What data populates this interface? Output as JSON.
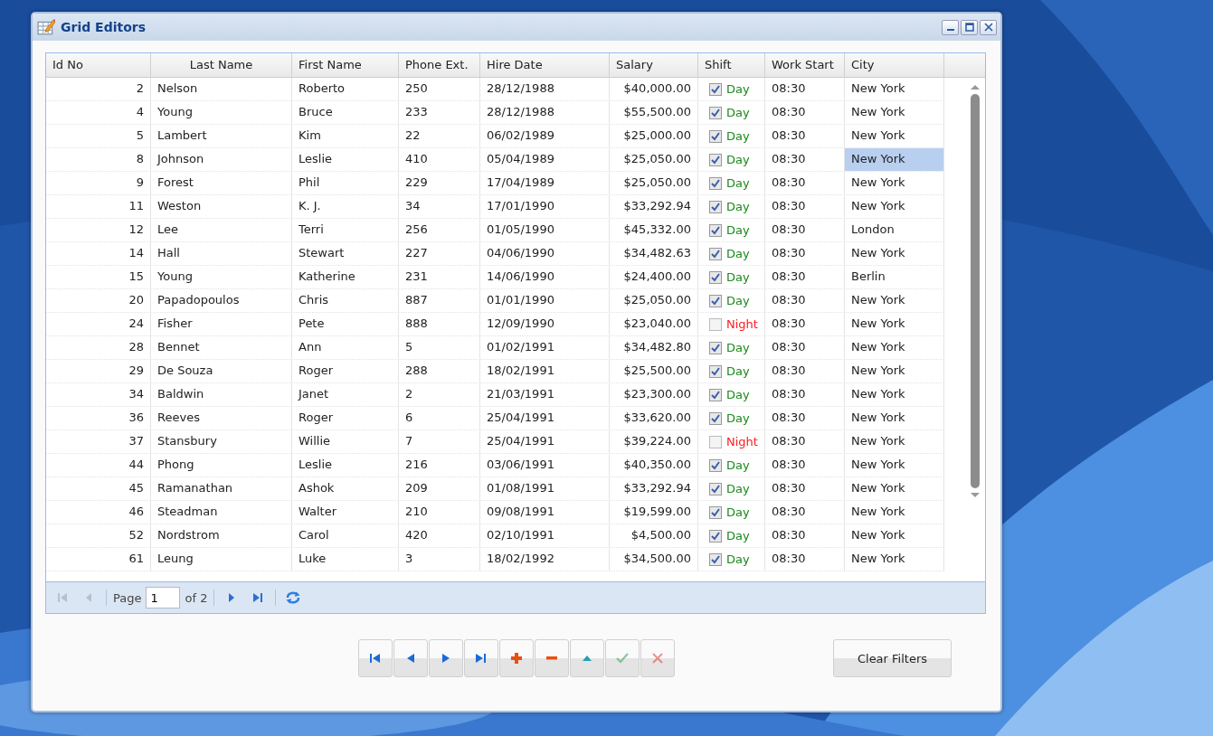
{
  "window": {
    "title": "Grid Editors"
  },
  "table": {
    "columns": [
      "Id No",
      "Last Name",
      "First Name",
      "Phone Ext.",
      "Hire Date",
      "Salary",
      "Shift",
      "Work Start",
      "City"
    ],
    "rows": [
      {
        "id": "2",
        "last": "Nelson",
        "first": "Roberto",
        "ext": "250",
        "hired": "28/12/1988",
        "salary": "$40,000.00",
        "shift": {
          "checked": true,
          "label": "Day"
        },
        "start": "08:30",
        "city": "New York",
        "selected": false
      },
      {
        "id": "4",
        "last": "Young",
        "first": "Bruce",
        "ext": "233",
        "hired": "28/12/1988",
        "salary": "$55,500.00",
        "shift": {
          "checked": true,
          "label": "Day"
        },
        "start": "08:30",
        "city": "New York",
        "selected": false
      },
      {
        "id": "5",
        "last": "Lambert",
        "first": "Kim",
        "ext": "22",
        "hired": "06/02/1989",
        "salary": "$25,000.00",
        "shift": {
          "checked": true,
          "label": "Day"
        },
        "start": "08:30",
        "city": "New York",
        "selected": false
      },
      {
        "id": "8",
        "last": "Johnson",
        "first": "Leslie",
        "ext": "410",
        "hired": "05/04/1989",
        "salary": "$25,050.00",
        "shift": {
          "checked": true,
          "label": "Day"
        },
        "start": "08:30",
        "city": "New York",
        "selected": true
      },
      {
        "id": "9",
        "last": "Forest",
        "first": "Phil",
        "ext": "229",
        "hired": "17/04/1989",
        "salary": "$25,050.00",
        "shift": {
          "checked": true,
          "label": "Day"
        },
        "start": "08:30",
        "city": "New York",
        "selected": false
      },
      {
        "id": "11",
        "last": "Weston",
        "first": "K. J.",
        "ext": "34",
        "hired": "17/01/1990",
        "salary": "$33,292.94",
        "shift": {
          "checked": true,
          "label": "Day"
        },
        "start": "08:30",
        "city": "New York",
        "selected": false
      },
      {
        "id": "12",
        "last": "Lee",
        "first": "Terri",
        "ext": "256",
        "hired": "01/05/1990",
        "salary": "$45,332.00",
        "shift": {
          "checked": true,
          "label": "Day"
        },
        "start": "08:30",
        "city": "London",
        "selected": false
      },
      {
        "id": "14",
        "last": "Hall",
        "first": "Stewart",
        "ext": "227",
        "hired": "04/06/1990",
        "salary": "$34,482.63",
        "shift": {
          "checked": true,
          "label": "Day"
        },
        "start": "08:30",
        "city": "New York",
        "selected": false
      },
      {
        "id": "15",
        "last": "Young",
        "first": "Katherine",
        "ext": "231",
        "hired": "14/06/1990",
        "salary": "$24,400.00",
        "shift": {
          "checked": true,
          "label": "Day"
        },
        "start": "08:30",
        "city": "Berlin",
        "selected": false
      },
      {
        "id": "20",
        "last": "Papadopoulos",
        "first": "Chris",
        "ext": "887",
        "hired": "01/01/1990",
        "salary": "$25,050.00",
        "shift": {
          "checked": true,
          "label": "Day"
        },
        "start": "08:30",
        "city": "New York",
        "selected": false
      },
      {
        "id": "24",
        "last": "Fisher",
        "first": "Pete",
        "ext": "888",
        "hired": "12/09/1990",
        "salary": "$23,040.00",
        "shift": {
          "checked": false,
          "label": "Night"
        },
        "start": "08:30",
        "city": "New York",
        "selected": false
      },
      {
        "id": "28",
        "last": "Bennet",
        "first": "Ann",
        "ext": "5",
        "hired": "01/02/1991",
        "salary": "$34,482.80",
        "shift": {
          "checked": true,
          "label": "Day"
        },
        "start": "08:30",
        "city": "New York",
        "selected": false
      },
      {
        "id": "29",
        "last": "De Souza",
        "first": "Roger",
        "ext": "288",
        "hired": "18/02/1991",
        "salary": "$25,500.00",
        "shift": {
          "checked": true,
          "label": "Day"
        },
        "start": "08:30",
        "city": "New York",
        "selected": false
      },
      {
        "id": "34",
        "last": "Baldwin",
        "first": "Janet",
        "ext": "2",
        "hired": "21/03/1991",
        "salary": "$23,300.00",
        "shift": {
          "checked": true,
          "label": "Day"
        },
        "start": "08:30",
        "city": "New York",
        "selected": false
      },
      {
        "id": "36",
        "last": "Reeves",
        "first": "Roger",
        "ext": "6",
        "hired": "25/04/1991",
        "salary": "$33,620.00",
        "shift": {
          "checked": true,
          "label": "Day"
        },
        "start": "08:30",
        "city": "New York",
        "selected": false
      },
      {
        "id": "37",
        "last": "Stansbury",
        "first": "Willie",
        "ext": "7",
        "hired": "25/04/1991",
        "salary": "$39,224.00",
        "shift": {
          "checked": false,
          "label": "Night"
        },
        "start": "08:30",
        "city": "New York",
        "selected": false
      },
      {
        "id": "44",
        "last": "Phong",
        "first": "Leslie",
        "ext": "216",
        "hired": "03/06/1991",
        "salary": "$40,350.00",
        "shift": {
          "checked": true,
          "label": "Day"
        },
        "start": "08:30",
        "city": "New York",
        "selected": false
      },
      {
        "id": "45",
        "last": "Ramanathan",
        "first": "Ashok",
        "ext": "209",
        "hired": "01/08/1991",
        "salary": "$33,292.94",
        "shift": {
          "checked": true,
          "label": "Day"
        },
        "start": "08:30",
        "city": "New York",
        "selected": false
      },
      {
        "id": "46",
        "last": "Steadman",
        "first": "Walter",
        "ext": "210",
        "hired": "09/08/1991",
        "salary": "$19,599.00",
        "shift": {
          "checked": true,
          "label": "Day"
        },
        "start": "08:30",
        "city": "New York",
        "selected": false
      },
      {
        "id": "52",
        "last": "Nordstrom",
        "first": "Carol",
        "ext": "420",
        "hired": "02/10/1991",
        "salary": "$4,500.00",
        "shift": {
          "checked": true,
          "label": "Day"
        },
        "start": "08:30",
        "city": "New York",
        "selected": false
      },
      {
        "id": "61",
        "last": "Leung",
        "first": "Luke",
        "ext": "3",
        "hired": "18/02/1992",
        "salary": "$34,500.00",
        "shift": {
          "checked": true,
          "label": "Day"
        },
        "start": "08:30",
        "city": "New York",
        "selected": false
      }
    ]
  },
  "pager": {
    "buttons_before": [
      {
        "kind": "first",
        "disabled": true
      },
      {
        "kind": "prev",
        "disabled": true
      }
    ],
    "page_label": "Page",
    "page_value": "1",
    "page_count": "of 2",
    "buttons_after": [
      {
        "kind": "next",
        "disabled": false
      },
      {
        "kind": "last",
        "disabled": false
      },
      {
        "kind": "refresh",
        "disabled": false
      }
    ]
  },
  "toolbar": {
    "buttons": [
      {
        "kind": "first",
        "disabled": false
      },
      {
        "kind": "prev",
        "disabled": false
      },
      {
        "kind": "next",
        "disabled": false
      },
      {
        "kind": "last",
        "disabled": false
      },
      {
        "kind": "add",
        "disabled": false
      },
      {
        "kind": "remove",
        "disabled": false
      },
      {
        "kind": "up",
        "disabled": false
      },
      {
        "kind": "accept",
        "disabled": true
      },
      {
        "kind": "cancel",
        "disabled": true
      }
    ],
    "clear_label": "Clear Filters"
  }
}
